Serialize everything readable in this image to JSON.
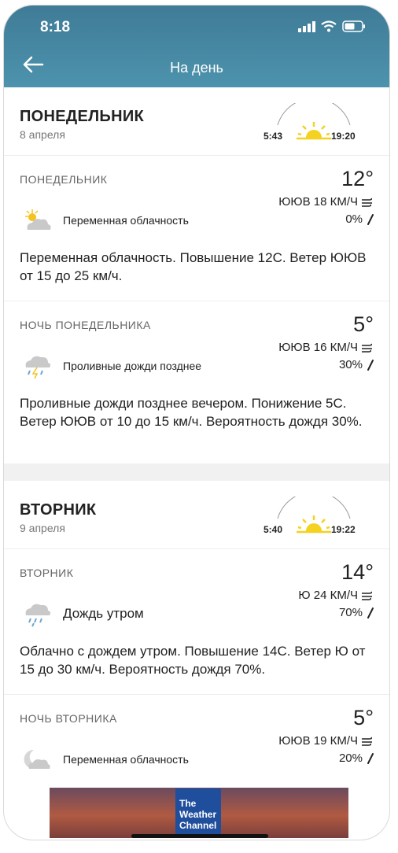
{
  "status": {
    "time": "8:18"
  },
  "header": {
    "title": "На день"
  },
  "days": [
    {
      "name": "ПОНЕДЕЛЬНИК",
      "date": "8 апреля",
      "sunrise": "5:43",
      "sunset": "19:20",
      "periods": [
        {
          "label": "ПОНЕДЕЛЬНИК",
          "temp": "12°",
          "wind": "ЮЮВ 18 КМ/Ч",
          "precip": "0%",
          "icon": "partly-cloudy-day-icon",
          "phrase": "Переменная облачность",
          "narrative": "Переменная облачность. Повышение 12С. Ветер ЮЮВ от 15 до 25 км/ч."
        },
        {
          "label": "НОЧЬ ПОНЕДЕЛЬНИКА",
          "temp": "5°",
          "wind": "ЮЮВ 16 КМ/Ч",
          "precip": "30%",
          "icon": "rain-showers-icon",
          "phrase": "Проливные дожди позднее",
          "narrative": "Проливные дожди позднее вечером. Понижение 5С. Ветер ЮЮВ от 10 до 15 км/ч. Вероятность дождя 30%."
        }
      ]
    },
    {
      "name": "ВТОРНИК",
      "date": "9 апреля",
      "sunrise": "5:40",
      "sunset": "19:22",
      "periods": [
        {
          "label": "ВТОРНИК",
          "temp": "14°",
          "wind": "Ю 24 КМ/Ч",
          "precip": "70%",
          "icon": "rain-icon",
          "phrase": "Дождь утром",
          "narrative": "Облачно с дождем утром. Повышение 14С. Ветер Ю от 15 до 30 км/ч. Вероятность дождя 70%."
        },
        {
          "label": "НОЧЬ ВТОРНИКА",
          "temp": "5°",
          "wind": "ЮЮВ 19 КМ/Ч",
          "precip": "20%",
          "icon": "partly-cloudy-night-icon",
          "phrase": "Переменная облачность",
          "narrative": ""
        }
      ]
    }
  ],
  "ad": {
    "logo_line1": "The",
    "logo_line2": "Weather",
    "logo_line3": "Channel"
  },
  "colors": {
    "header": "#4a8ba7",
    "sun": "#f5d21f",
    "accent": "#222222"
  }
}
